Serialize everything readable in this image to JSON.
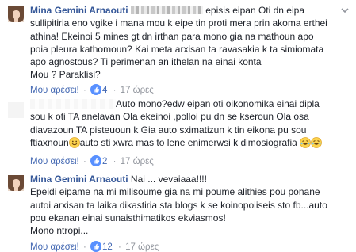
{
  "comments": [
    {
      "author": "Mina Gemini Arnaouti",
      "lines": [
        " episis eipan Oti dn eipa",
        "sullipitiria eno vgike i mana mou k eipe tin proti mera prin akoma erthei",
        "athina! Ekeinoi 5 mines gt dn irthan para mono gia na mathoun apo",
        "poia pleura kathomoun? Kai meta arxisan ta ravasakia k ta simiomata",
        "apo agnostous? Ti perimenan an ithelan na einai konta",
        "Mou ? Paraklisi?"
      ],
      "like_label": "Μου αρέσει!",
      "reaction_count": "4",
      "time": "17 ώρες"
    },
    {
      "author": "",
      "lines": [
        "Auto mono?edw eipan oti oikonomika einai dipla",
        "sou k oti TA anelavan Ola ekeinoi ,polloi pu dn se kseroun Ola osa",
        "diavazoun TA pisteuoun k Gia auto sximatizun k tin eikona pu sou",
        "ftiaxnoun",
        "auto sti xwra mas to lene enimerwsi k dimosiografia"
      ],
      "like_label": "Μου αρέσει!",
      "reaction_count": "2",
      "time": "17 ώρες"
    },
    {
      "author": "Mina Gemini Arnaouti",
      "lines": [
        " Nai ... vevaiaaa!!!!",
        "Epeidi eipame na mi milisoume gia na mi poume alithies pou ponane",
        "autoi arxisan ta laika dikastiria sta blogs k se koinopoiiseis sto fb...auto",
        "pou ekanan einai sunaisthimatikos ekviasmos!",
        "Mono ntropi..."
      ],
      "like_label": "Μου αρέσει!",
      "reaction_count": "12",
      "time": "17 ώρες"
    }
  ],
  "separator": "·",
  "colors": {
    "link": "#365899",
    "like": "#4267b2",
    "meta": "#90949c",
    "text": "#1d2129"
  }
}
